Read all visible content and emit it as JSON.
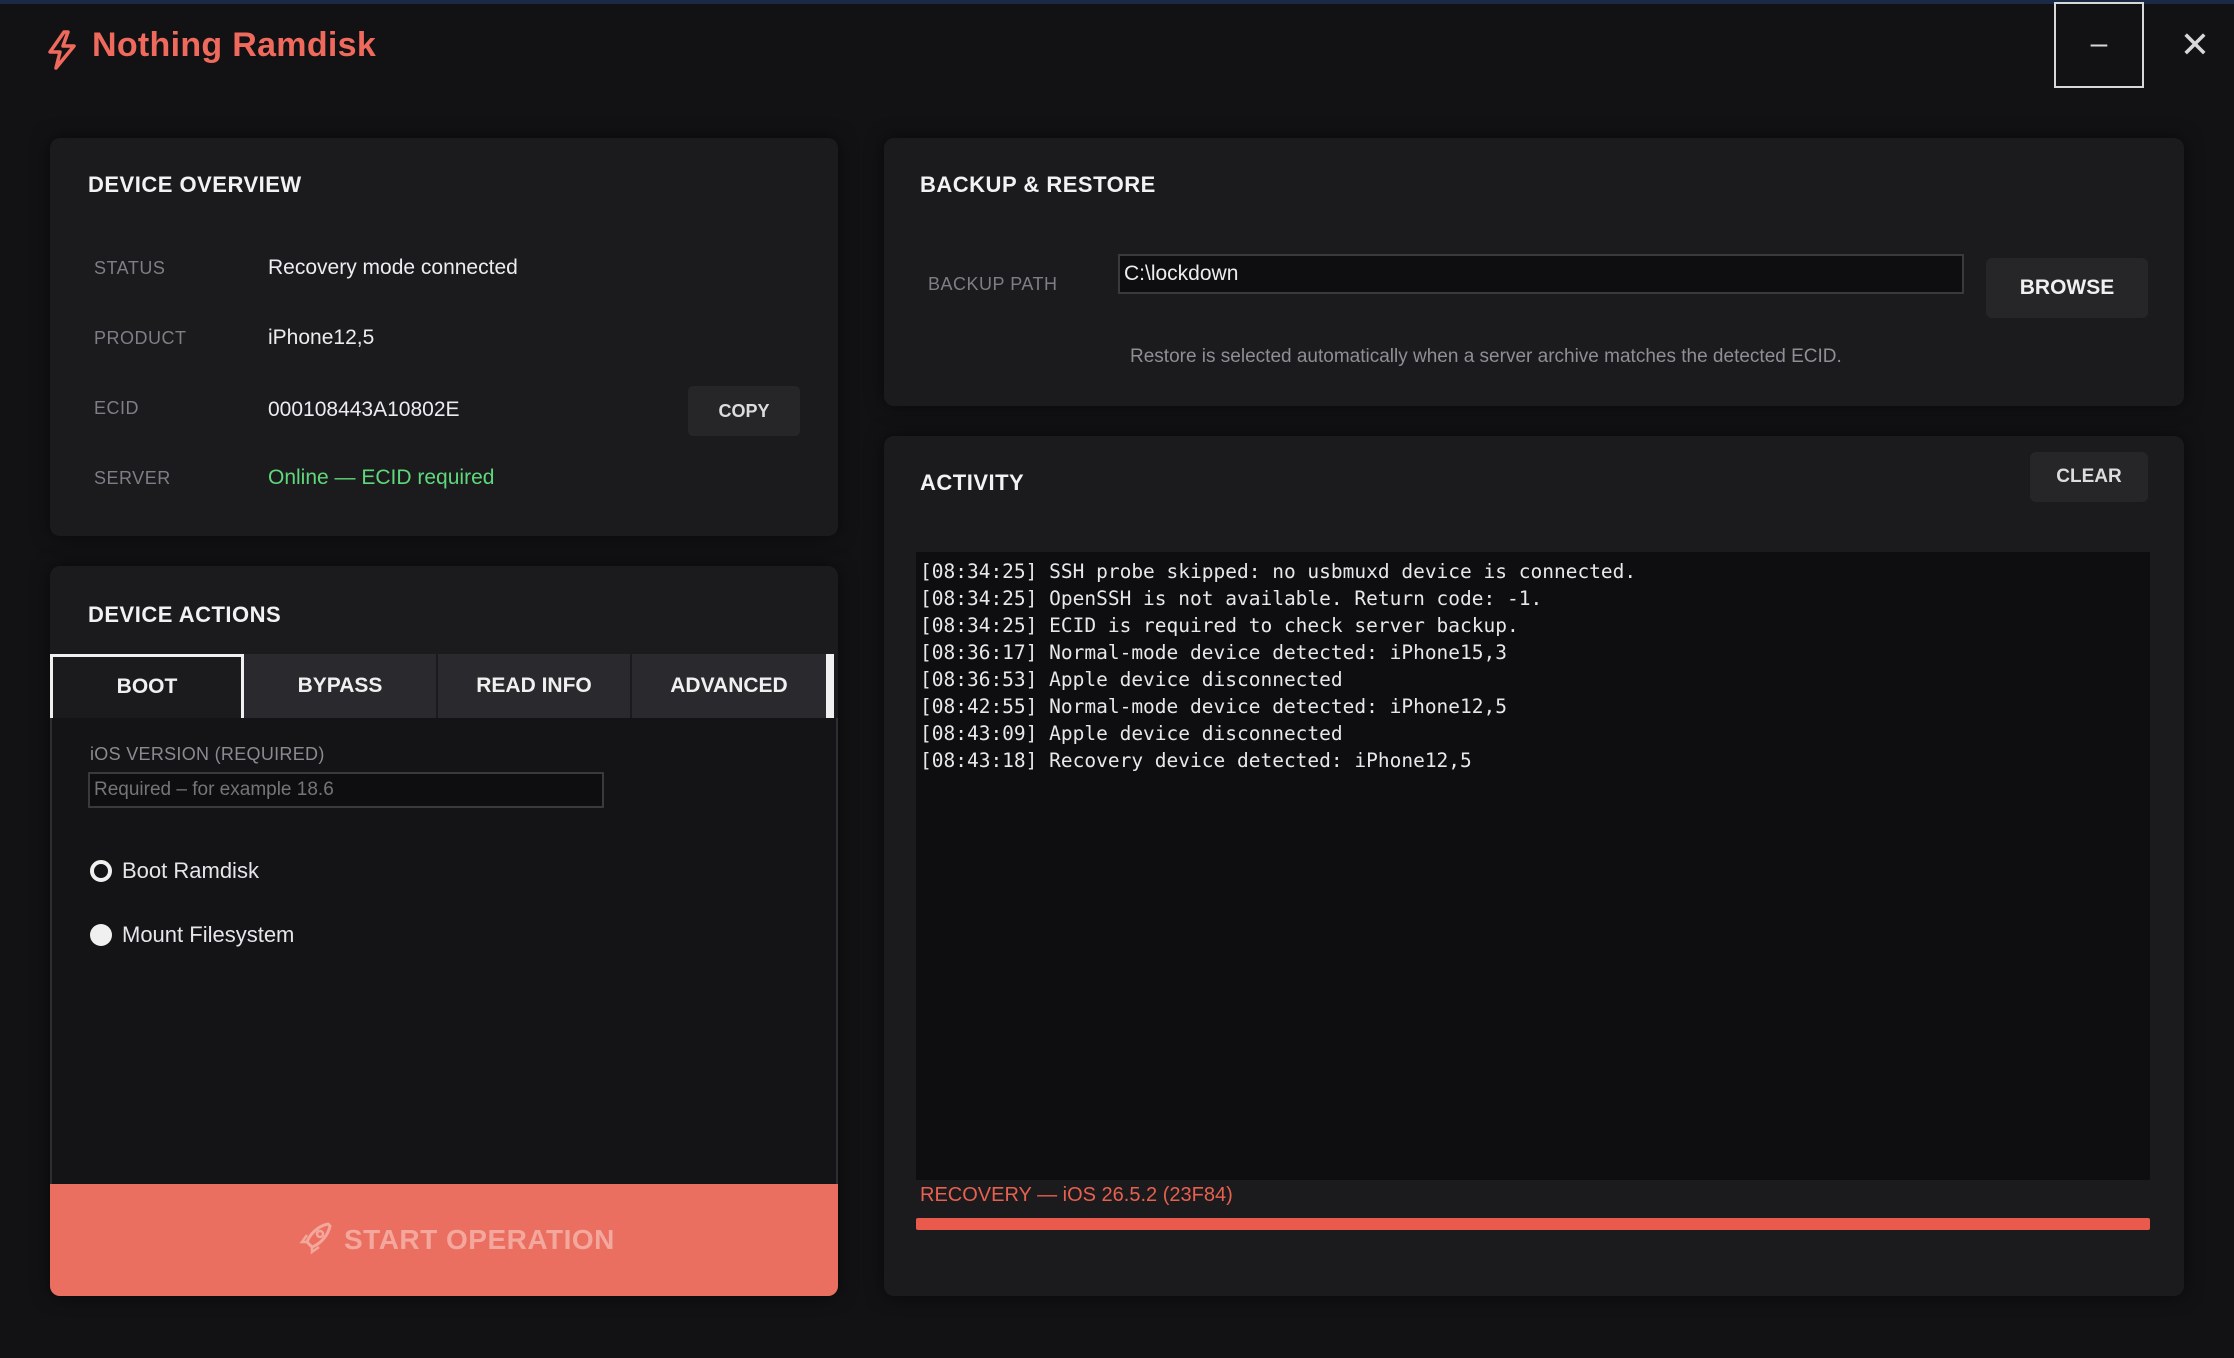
{
  "app": {
    "title": "Nothing Ramdisk",
    "minimize_glyph": "–",
    "close_glyph": "✕",
    "accent_color": "#ef6a5c"
  },
  "device_overview": {
    "title": "DEVICE OVERVIEW",
    "rows": [
      {
        "label": "STATUS",
        "value": "Recovery mode connected"
      },
      {
        "label": "PRODUCT",
        "value": "iPhone12,5"
      },
      {
        "label": "ECID",
        "value": "000108443A10802E"
      },
      {
        "label": "SERVER",
        "value": "Online — ECID required",
        "color": "#5fd87b"
      }
    ],
    "copy_label": "COPY"
  },
  "device_actions": {
    "title": "DEVICE ACTIONS",
    "tabs": [
      {
        "label": "BOOT",
        "active": true
      },
      {
        "label": "BYPASS",
        "active": false
      },
      {
        "label": "READ INFO",
        "active": false
      },
      {
        "label": "ADVANCED",
        "active": false
      }
    ],
    "ios_version_label": "iOS VERSION (REQUIRED)",
    "ios_version_placeholder": "Required – for example 18.6",
    "ios_version_value": "",
    "options": [
      {
        "label": "Boot Ramdisk",
        "selected": true
      },
      {
        "label": "Mount Filesystem",
        "selected": false
      }
    ],
    "start_label": "START OPERATION",
    "start_icon": "rocket-icon"
  },
  "backup_restore": {
    "title": "BACKUP & RESTORE",
    "path_label": "BACKUP PATH",
    "path_value": "C:\\lockdown",
    "browse_label": "BROWSE",
    "hint": "Restore is selected automatically when a server archive matches the detected ECID."
  },
  "activity": {
    "title": "ACTIVITY",
    "clear_label": "CLEAR",
    "log": [
      "[08:34:25] SSH probe skipped: no usbmuxd device is connected.",
      "[08:34:25] OpenSSH is not available. Return code: -1.",
      "[08:34:25] ECID is required to check server backup.",
      "[08:36:17] Normal-mode device detected: iPhone15,3",
      "[08:36:53] Apple device disconnected",
      "[08:42:55] Normal-mode device detected: iPhone12,5",
      "[08:43:09] Apple device disconnected",
      "[08:43:18] Recovery device detected: iPhone12,5"
    ],
    "status": "RECOVERY — iOS 26.5.2 (23F84)",
    "progress_percent": 100
  }
}
